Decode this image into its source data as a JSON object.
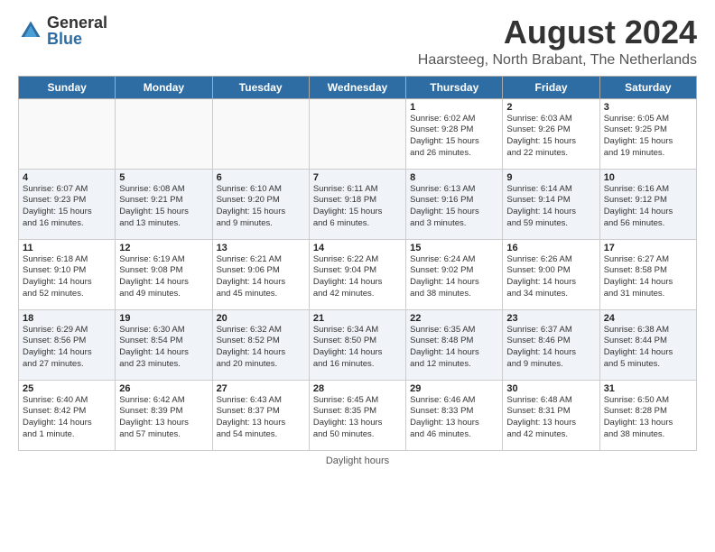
{
  "logo": {
    "text_general": "General",
    "text_blue": "Blue"
  },
  "title": "August 2024",
  "location": "Haarsteeg, North Brabant, The Netherlands",
  "footer": "Daylight hours",
  "columns": [
    "Sunday",
    "Monday",
    "Tuesday",
    "Wednesday",
    "Thursday",
    "Friday",
    "Saturday"
  ],
  "weeks": [
    [
      {
        "day": "",
        "info": ""
      },
      {
        "day": "",
        "info": ""
      },
      {
        "day": "",
        "info": ""
      },
      {
        "day": "",
        "info": ""
      },
      {
        "day": "1",
        "info": "Sunrise: 6:02 AM\nSunset: 9:28 PM\nDaylight: 15 hours\nand 26 minutes."
      },
      {
        "day": "2",
        "info": "Sunrise: 6:03 AM\nSunset: 9:26 PM\nDaylight: 15 hours\nand 22 minutes."
      },
      {
        "day": "3",
        "info": "Sunrise: 6:05 AM\nSunset: 9:25 PM\nDaylight: 15 hours\nand 19 minutes."
      }
    ],
    [
      {
        "day": "4",
        "info": "Sunrise: 6:07 AM\nSunset: 9:23 PM\nDaylight: 15 hours\nand 16 minutes."
      },
      {
        "day": "5",
        "info": "Sunrise: 6:08 AM\nSunset: 9:21 PM\nDaylight: 15 hours\nand 13 minutes."
      },
      {
        "day": "6",
        "info": "Sunrise: 6:10 AM\nSunset: 9:20 PM\nDaylight: 15 hours\nand 9 minutes."
      },
      {
        "day": "7",
        "info": "Sunrise: 6:11 AM\nSunset: 9:18 PM\nDaylight: 15 hours\nand 6 minutes."
      },
      {
        "day": "8",
        "info": "Sunrise: 6:13 AM\nSunset: 9:16 PM\nDaylight: 15 hours\nand 3 minutes."
      },
      {
        "day": "9",
        "info": "Sunrise: 6:14 AM\nSunset: 9:14 PM\nDaylight: 14 hours\nand 59 minutes."
      },
      {
        "day": "10",
        "info": "Sunrise: 6:16 AM\nSunset: 9:12 PM\nDaylight: 14 hours\nand 56 minutes."
      }
    ],
    [
      {
        "day": "11",
        "info": "Sunrise: 6:18 AM\nSunset: 9:10 PM\nDaylight: 14 hours\nand 52 minutes."
      },
      {
        "day": "12",
        "info": "Sunrise: 6:19 AM\nSunset: 9:08 PM\nDaylight: 14 hours\nand 49 minutes."
      },
      {
        "day": "13",
        "info": "Sunrise: 6:21 AM\nSunset: 9:06 PM\nDaylight: 14 hours\nand 45 minutes."
      },
      {
        "day": "14",
        "info": "Sunrise: 6:22 AM\nSunset: 9:04 PM\nDaylight: 14 hours\nand 42 minutes."
      },
      {
        "day": "15",
        "info": "Sunrise: 6:24 AM\nSunset: 9:02 PM\nDaylight: 14 hours\nand 38 minutes."
      },
      {
        "day": "16",
        "info": "Sunrise: 6:26 AM\nSunset: 9:00 PM\nDaylight: 14 hours\nand 34 minutes."
      },
      {
        "day": "17",
        "info": "Sunrise: 6:27 AM\nSunset: 8:58 PM\nDaylight: 14 hours\nand 31 minutes."
      }
    ],
    [
      {
        "day": "18",
        "info": "Sunrise: 6:29 AM\nSunset: 8:56 PM\nDaylight: 14 hours\nand 27 minutes."
      },
      {
        "day": "19",
        "info": "Sunrise: 6:30 AM\nSunset: 8:54 PM\nDaylight: 14 hours\nand 23 minutes."
      },
      {
        "day": "20",
        "info": "Sunrise: 6:32 AM\nSunset: 8:52 PM\nDaylight: 14 hours\nand 20 minutes."
      },
      {
        "day": "21",
        "info": "Sunrise: 6:34 AM\nSunset: 8:50 PM\nDaylight: 14 hours\nand 16 minutes."
      },
      {
        "day": "22",
        "info": "Sunrise: 6:35 AM\nSunset: 8:48 PM\nDaylight: 14 hours\nand 12 minutes."
      },
      {
        "day": "23",
        "info": "Sunrise: 6:37 AM\nSunset: 8:46 PM\nDaylight: 14 hours\nand 9 minutes."
      },
      {
        "day": "24",
        "info": "Sunrise: 6:38 AM\nSunset: 8:44 PM\nDaylight: 14 hours\nand 5 minutes."
      }
    ],
    [
      {
        "day": "25",
        "info": "Sunrise: 6:40 AM\nSunset: 8:42 PM\nDaylight: 14 hours\nand 1 minute."
      },
      {
        "day": "26",
        "info": "Sunrise: 6:42 AM\nSunset: 8:39 PM\nDaylight: 13 hours\nand 57 minutes."
      },
      {
        "day": "27",
        "info": "Sunrise: 6:43 AM\nSunset: 8:37 PM\nDaylight: 13 hours\nand 54 minutes."
      },
      {
        "day": "28",
        "info": "Sunrise: 6:45 AM\nSunset: 8:35 PM\nDaylight: 13 hours\nand 50 minutes."
      },
      {
        "day": "29",
        "info": "Sunrise: 6:46 AM\nSunset: 8:33 PM\nDaylight: 13 hours\nand 46 minutes."
      },
      {
        "day": "30",
        "info": "Sunrise: 6:48 AM\nSunset: 8:31 PM\nDaylight: 13 hours\nand 42 minutes."
      },
      {
        "day": "31",
        "info": "Sunrise: 6:50 AM\nSunset: 8:28 PM\nDaylight: 13 hours\nand 38 minutes."
      }
    ]
  ]
}
